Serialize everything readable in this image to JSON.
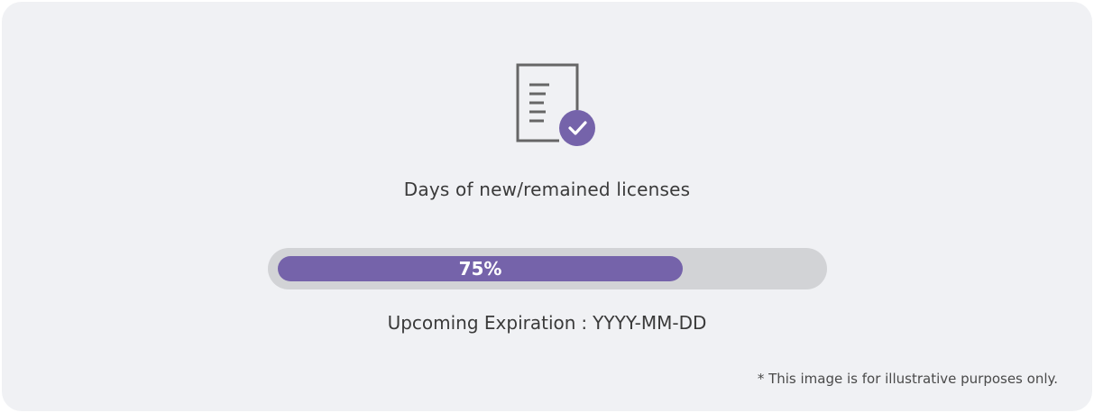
{
  "license_card": {
    "icon": "document-check-icon",
    "title": "Days of new/remained licenses",
    "progress": {
      "percent": 75,
      "label": "75%",
      "fill_color": "#7563aa",
      "track_color": "#d2d3d6"
    },
    "expiration": {
      "label": "Upcoming Expiration",
      "separator": ":",
      "value": "YYYY-MM-DD"
    },
    "disclaimer": "* This image is for illustrative purposes only.",
    "colors": {
      "background": "#f0f1f4",
      "accent": "#7563aa",
      "icon_stroke": "#666666"
    }
  }
}
